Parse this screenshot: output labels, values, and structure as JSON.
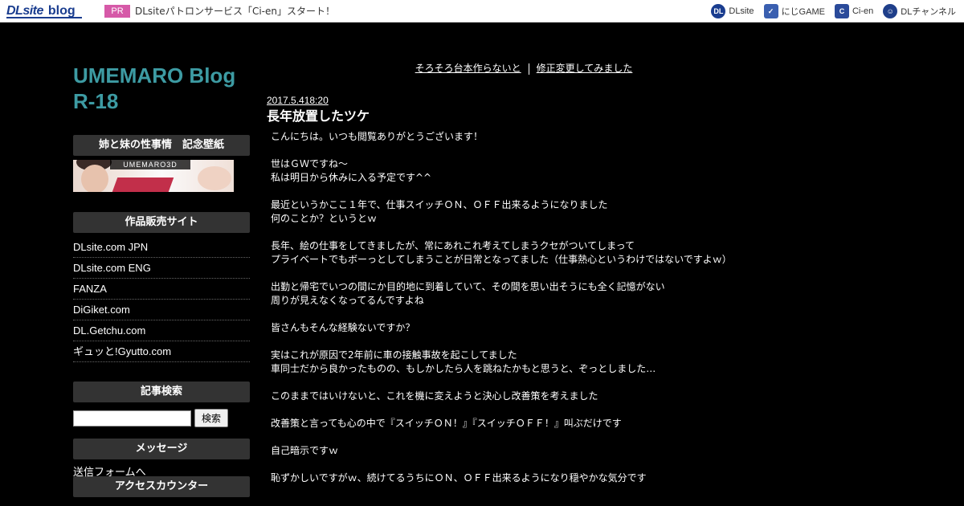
{
  "topbar": {
    "logo_dl": "DLsite",
    "logo_blog": "blog",
    "pr_badge": "PR",
    "pr_text": "DLsiteパトロンサービス「Ci-en」スタート！",
    "links": [
      {
        "label": "DLsite",
        "icon": "dlsite-icon",
        "color": "#1a3d8f",
        "glyph": "DL"
      },
      {
        "label": "にじGAME",
        "icon": "nijigame-icon",
        "color": "#3a5fb0",
        "glyph": "✓"
      },
      {
        "label": "Ci-en",
        "icon": "cien-icon",
        "color": "#2a4a9a",
        "glyph": "C"
      },
      {
        "label": "DLチャンネル",
        "icon": "dlchannel-icon",
        "color": "#1f3f8a",
        "glyph": "☺"
      }
    ]
  },
  "sidebar": {
    "blog_title_line1": "UMEMARO Blog",
    "blog_title_line2": "R-18",
    "wallpaper_heading": "姉と妹の性事情　記念壁紙",
    "banner_text": "UMEMARO3D",
    "sales_heading": "作品販売サイト",
    "sales_sites": [
      "DLsite.com JPN",
      "DLsite.com ENG",
      "FANZA",
      "DiGiket.com",
      "DL.Getchu.com",
      "ギュッと!Gyutto.com"
    ],
    "search_heading": "記事検索",
    "search_button": "検索",
    "search_value": "",
    "message_heading": "メッセージ",
    "message_link": "送信フォームへ",
    "counter_heading": "アクセスカウンター"
  },
  "main": {
    "prev_link": "そろそろ台本作らないと",
    "next_link": "修正変更してみました",
    "post_date": "2017.5.418:20",
    "post_title": "長年放置したツケ",
    "body_lines": [
      "こんにちは。いつも閲覧ありがとうございます！",
      "",
      "世はＧＷですね～",
      "私は明日から休みに入る予定です^^",
      "",
      "最近というかここ１年で、仕事スイッチＯＮ、ＯＦＦ出来るようになりました",
      "何のことか？というとｗ",
      "",
      "長年、絵の仕事をしてきましたが、常にあれこれ考えてしまうクセがついてしまって",
      "プライベートでもボーっとしてしまうことが日常となってました（仕事熱心というわけではないですよｗ）",
      "",
      "出勤と帰宅でいつの間にか目的地に到着していて、その間を思い出そうにも全く記憶がない",
      "周りが見えなくなってるんですよね",
      "",
      "皆さんもそんな経験ないですか？",
      "",
      "実はこれが原因で2年前に車の接触事故を起こしてました",
      "車同士だから良かったものの、もしかしたら人を跳ねたかもと思うと、ぞっとしました…",
      "",
      "このままではいけないと、これを機に変えようと決心し改善策を考えました",
      "",
      "改善策と言っても心の中で『スイッチＯＮ！』『スイッチＯＦＦ！』叫ぶだけです",
      "",
      "自己暗示ですｗ",
      "",
      "恥ずかしいですがｗ、続けてるうちにＯＮ、ＯＦＦ出来るようになり穏やかな気分です"
    ]
  }
}
